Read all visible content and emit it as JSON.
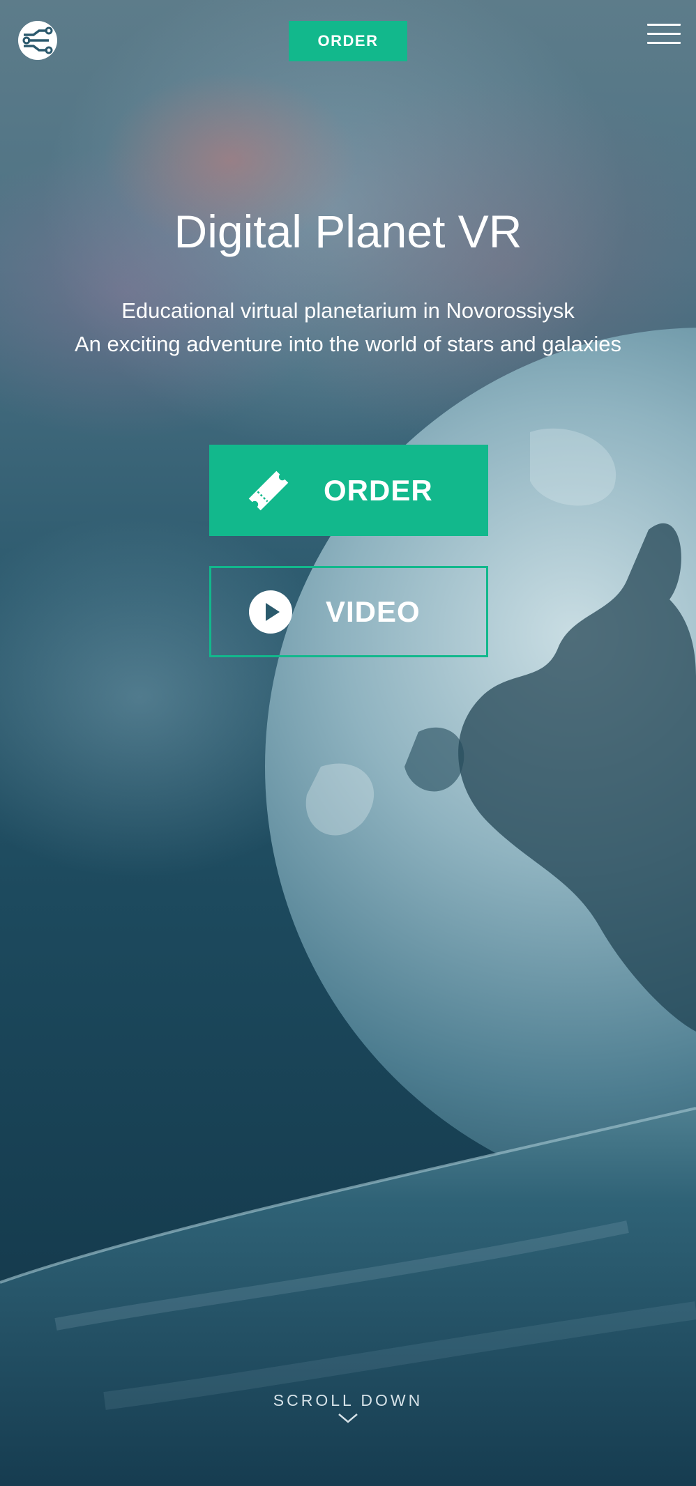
{
  "header": {
    "logo_icon": "circuit-logo-icon",
    "order_label": "ORDER",
    "menu_icon": "hamburger-menu-icon"
  },
  "hero": {
    "title": "Digital Planet VR",
    "subtitle_line1": "Educational virtual planetarium in Novorossiysk",
    "subtitle_line2": "An exciting adventure into the world of stars and galaxies",
    "order_button": {
      "label": "ORDER",
      "icon": "ticket-icon"
    },
    "video_button": {
      "label": "VIDEO",
      "icon": "play-circle-icon"
    }
  },
  "footer": {
    "scroll_label": "SCROLL DOWN",
    "scroll_icon": "chevron-down-icon"
  },
  "colors": {
    "accent": "#12b88c",
    "text": "#ffffff"
  }
}
